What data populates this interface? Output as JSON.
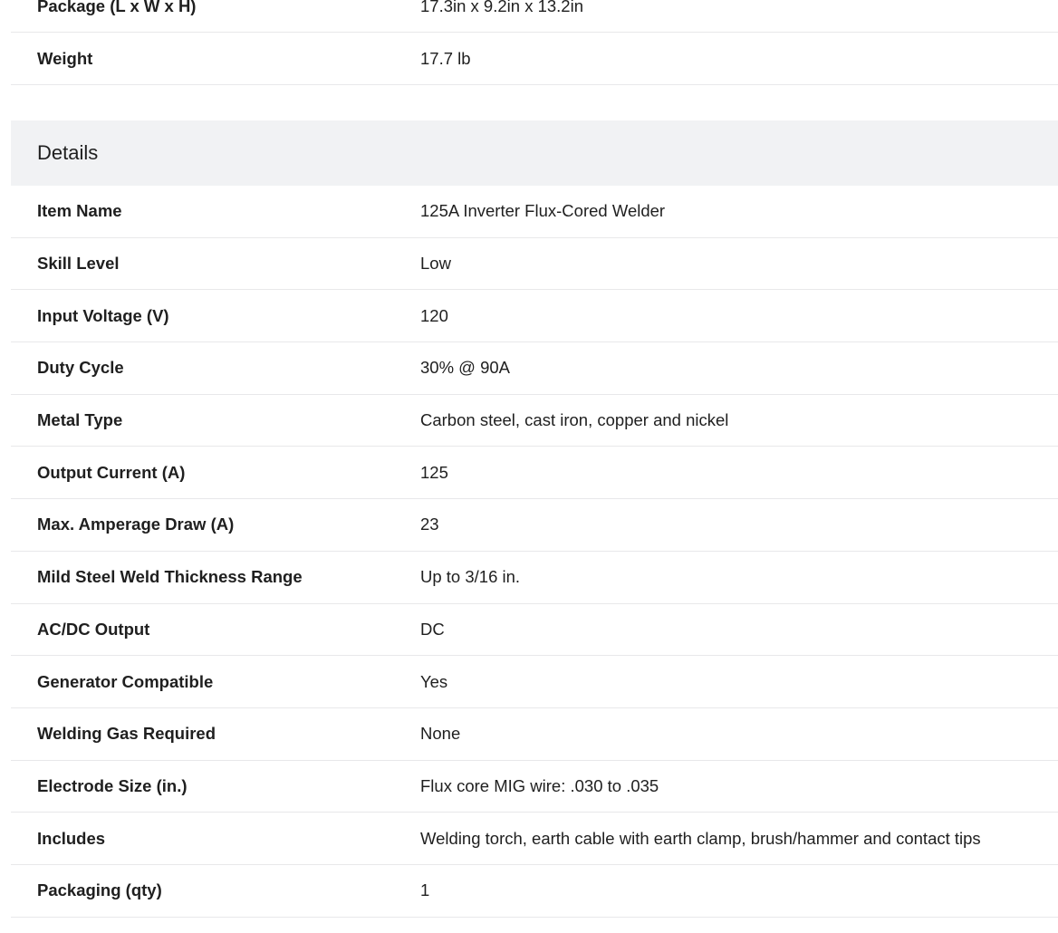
{
  "dimensions": {
    "rows": [
      {
        "label": "Package (L x W x H)",
        "value": "17.3in x 9.2in x 13.2in"
      },
      {
        "label": "Weight",
        "value": "17.7 lb"
      }
    ]
  },
  "details": {
    "title": "Details",
    "rows": [
      {
        "label": "Item Name",
        "value": "125A Inverter Flux-Cored Welder"
      },
      {
        "label": "Skill Level",
        "value": "Low"
      },
      {
        "label": "Input Voltage (V)",
        "value": "120"
      },
      {
        "label": "Duty Cycle",
        "value": "30% @ 90A"
      },
      {
        "label": "Metal Type",
        "value": "Carbon steel, cast iron, copper and nickel"
      },
      {
        "label": "Output Current (A)",
        "value": "125"
      },
      {
        "label": "Max. Amperage Draw (A)",
        "value": "23"
      },
      {
        "label": "Mild Steel Weld Thickness Range",
        "value": "Up to 3/16 in."
      },
      {
        "label": "AC/DC Output",
        "value": "DC"
      },
      {
        "label": "Generator Compatible",
        "value": "Yes"
      },
      {
        "label": "Welding Gas Required",
        "value": "None"
      },
      {
        "label": "Electrode Size (in.)",
        "value": "Flux core MIG wire: .030 to .035"
      },
      {
        "label": "Includes",
        "value": "Welding torch, earth cable with earth clamp, brush/hammer and contact tips"
      },
      {
        "label": "Packaging (qty)",
        "value": "1"
      }
    ]
  }
}
